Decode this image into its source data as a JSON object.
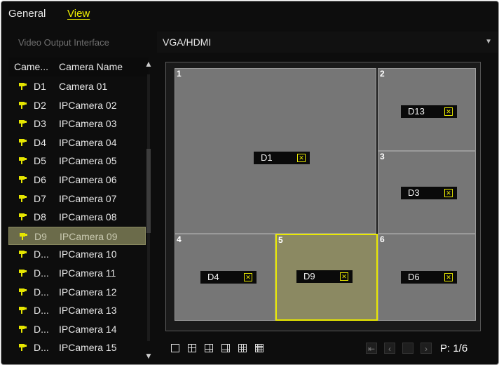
{
  "tabs": {
    "general": "General",
    "view": "View"
  },
  "output": {
    "label": "Video Output Interface",
    "value": "VGA/HDMI"
  },
  "camera_list": {
    "header_id": "Came...",
    "header_name": "Camera Name",
    "rows": [
      {
        "id": "D1",
        "name": "Camera 01"
      },
      {
        "id": "D2",
        "name": "IPCamera 02"
      },
      {
        "id": "D3",
        "name": "IPCamera 03"
      },
      {
        "id": "D4",
        "name": "IPCamera 04"
      },
      {
        "id": "D5",
        "name": "IPCamera 05"
      },
      {
        "id": "D6",
        "name": "IPCamera 06"
      },
      {
        "id": "D7",
        "name": "IPCamera 07"
      },
      {
        "id": "D8",
        "name": "IPCamera 08"
      },
      {
        "id": "D9",
        "name": "IPCamera 09"
      },
      {
        "id": "D...",
        "name": "IPCamera 10"
      },
      {
        "id": "D...",
        "name": "IPCamera 11"
      },
      {
        "id": "D...",
        "name": "IPCamera 12"
      },
      {
        "id": "D...",
        "name": "IPCamera 13"
      },
      {
        "id": "D...",
        "name": "IPCamera 14"
      },
      {
        "id": "D...",
        "name": "IPCamera 15"
      }
    ],
    "selected_index": 8
  },
  "layout": {
    "windows": [
      {
        "num": "1",
        "camera": "D1"
      },
      {
        "num": "2",
        "camera": "D13"
      },
      {
        "num": "3",
        "camera": "D3"
      },
      {
        "num": "4",
        "camera": "D4"
      },
      {
        "num": "5",
        "camera": "D9"
      },
      {
        "num": "6",
        "camera": "D6"
      }
    ],
    "selected_window": "5"
  },
  "toolbar": {
    "layout_icons": [
      "layout-1x1-icon",
      "layout-2x2-icon",
      "layout-1plus5-icon",
      "layout-1plus7-icon",
      "layout-3x3-icon",
      "layout-4x4-icon"
    ],
    "page": "P: 1/6"
  },
  "colors": {
    "accent": "#e8e800",
    "cell": "#767676",
    "selected_cell": "#8b8962",
    "background": "#0d0d0d"
  }
}
